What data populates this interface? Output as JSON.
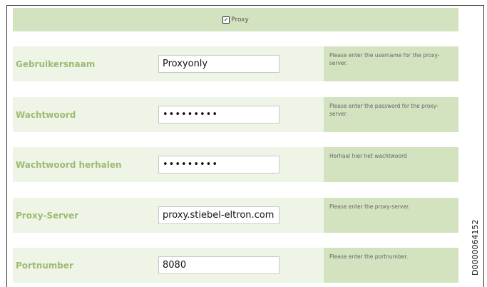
{
  "proxy": {
    "checked": true,
    "label": "Proxy",
    "check_glyph": "✓"
  },
  "fields": [
    {
      "label": "Gebruikersnaam",
      "value": "Proxyonly",
      "help": "Please enter the username for the proxy-server."
    },
    {
      "label": "Wachtwoord",
      "value": "•••••••••",
      "help": "Please enter the password for the proxy-server."
    },
    {
      "label": "Wachtwoord herhalen",
      "value": "•••••••••",
      "help": "Herhaal hier het wachtwoord"
    },
    {
      "label": "Proxy-Server",
      "value": "proxy.stiebel-eltron.com",
      "help": "Please enter the proxy-server."
    },
    {
      "label": "Portnumber",
      "value": "8080",
      "help": "Please enter the portnumber."
    }
  ],
  "document_code": "D0000064152"
}
